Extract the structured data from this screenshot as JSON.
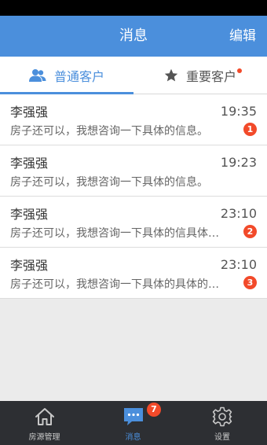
{
  "nav": {
    "title": "消息",
    "edit": "编辑"
  },
  "tabs": [
    {
      "label": "普通客户",
      "icon": "people-icon",
      "active": true
    },
    {
      "label": "重要客户",
      "icon": "star-icon",
      "active": false,
      "has_dot": true
    }
  ],
  "messages": [
    {
      "name": "李强强",
      "time": "19:35",
      "preview": "房子还可以，我想咨询一下具体的信息。",
      "badge": "1"
    },
    {
      "name": "李强强",
      "time": "19:23",
      "preview": "房子还可以，我想咨询一下具体的信息。",
      "badge": ""
    },
    {
      "name": "李强强",
      "time": "23:10",
      "preview": "房子还可以，我想咨询一下具体的信具体…",
      "badge": "2"
    },
    {
      "name": "李强强",
      "time": "23:10",
      "preview": "房子还可以，我想咨询一下具体的具体的…",
      "badge": "3"
    }
  ],
  "tab_bar": [
    {
      "label": "房源管理",
      "icon": "home-icon",
      "active": false
    },
    {
      "label": "消息",
      "icon": "chat-icon",
      "active": true,
      "badge": "7"
    },
    {
      "label": "设置",
      "icon": "gear-icon",
      "active": false
    }
  ],
  "colors": {
    "accent": "#4b8fdc",
    "badge": "#f24a2a",
    "tab_bar_bg": "#2d2f33"
  }
}
